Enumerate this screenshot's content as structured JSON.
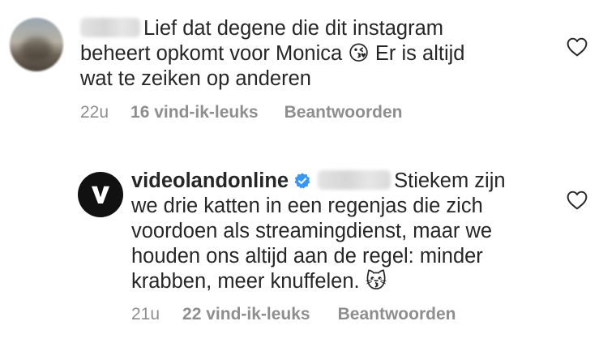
{
  "comments": [
    {
      "author_hidden": true,
      "text_lines": [
        "Lief dat degene die dit instagram",
        "beheert opkomt voor Monica 😘 Er is altijd",
        "wat te zeiken op anderen"
      ],
      "time": "22u",
      "likes": "16 vind-ik-leuks",
      "reply": "Beantwoorden",
      "like_icon": "heart-outline-icon"
    },
    {
      "author": "videolandonline",
      "verified_icon": "verified-badge-icon",
      "mention_hidden": true,
      "avatar_letter": "V",
      "text_first": "Stiekem zijn",
      "text_lines": [
        "we drie katten in een regenjas die zich",
        "voordoen als streamingdienst, maar we",
        "houden ons altijd aan de regel: minder",
        "krabben, meer knuffelen. 😽"
      ],
      "time": "21u",
      "likes": "22 vind-ik-leuks",
      "reply": "Beantwoorden",
      "like_icon": "heart-outline-icon"
    }
  ],
  "colors": {
    "text": "#262626",
    "meta": "#8e8e8e",
    "verified": "#3897f0",
    "logo_bg": "#111111"
  }
}
